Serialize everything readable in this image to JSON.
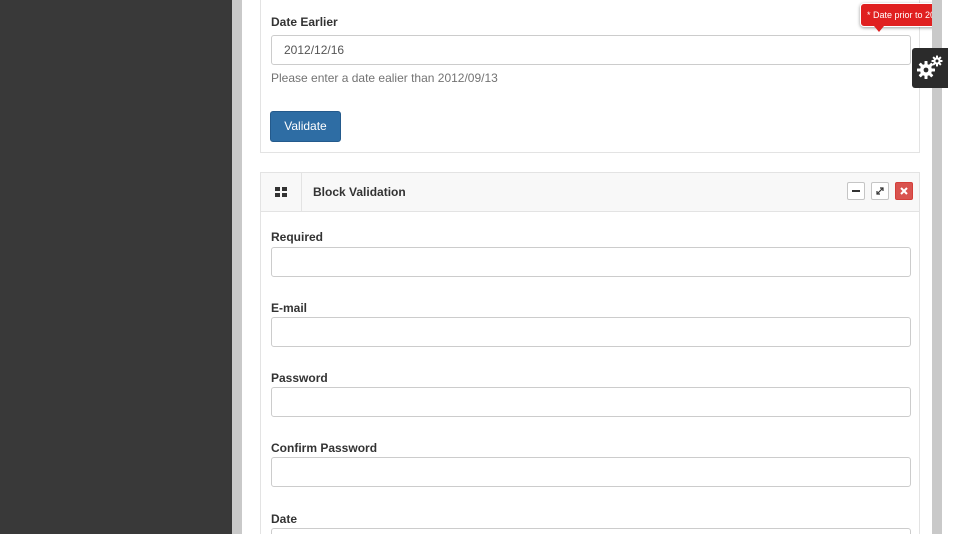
{
  "top_form": {
    "date_earlier_label": "Date Earlier",
    "date_earlier_value": "2012/12/16",
    "date_earlier_help": "Please enter a date ealier than 2012/09/13",
    "validate_label": "Validate",
    "error_tooltip": "* Date prior to 20"
  },
  "block_validation": {
    "title": "Block Validation",
    "fields": {
      "required_label": "Required",
      "required_value": "",
      "email_label": "E-mail",
      "email_value": "",
      "password_label": "Password",
      "password_value": "",
      "confirm_password_label": "Confirm Password",
      "confirm_password_value": "",
      "date_label": "Date",
      "date_value": ""
    },
    "tools": [
      "minimize-icon",
      "expand-icon",
      "close-icon"
    ]
  },
  "icons": {
    "settings": "gears-icon",
    "panel": "grid-icon"
  },
  "colors": {
    "primary_button": "#2e6da4",
    "error": "#e02020",
    "close_button": "#d9534f",
    "sidebar": "#393939"
  }
}
